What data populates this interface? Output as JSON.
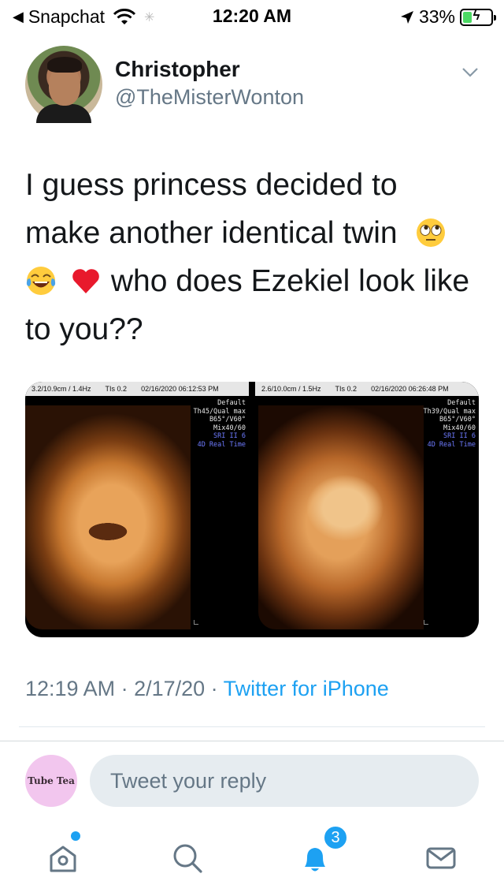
{
  "status_bar": {
    "back_app": "Snapchat",
    "time": "12:20 AM",
    "battery_percent": "33%",
    "battery_level": 0.33,
    "icons": [
      "back-arrow-icon",
      "wifi-icon",
      "loading-spinner-icon",
      "location-arrow-icon",
      "battery-charging-icon"
    ]
  },
  "tweet": {
    "display_name": "Christopher",
    "handle": "@TheMisterWonton",
    "text_lines": [
      "I guess princess decided to",
      "make another identical twin",
      "who does Ezekiel look like",
      "to you??"
    ],
    "emojis": [
      "face-with-rolling-eyes",
      "face-with-tears-of-joy",
      "red-heart"
    ],
    "timestamp": "12:19 AM · 2/17/20 · ",
    "source": "Twitter for iPhone"
  },
  "media": {
    "scan_left": {
      "top_params": "3.2/10.9cm / 1.4Hz",
      "top_tis": "TIs 0.2",
      "top_date": "02/16/2020  06:12:53 PM",
      "info": [
        "Default",
        "Th45/Qual max",
        "B65°/V60°",
        "Mix40/60"
      ],
      "info_blue": [
        "SRI II 6",
        "4D Real Time"
      ]
    },
    "scan_right": {
      "top_params": "2.6/10.0cm / 1.5Hz",
      "top_tis": "TIs 0.2",
      "top_date": "02/16/2020  06:26:48 PM",
      "info": [
        "Default",
        "Th39/Qual max",
        "B65°/V60°",
        "Mix40/60"
      ],
      "info_blue": [
        "SRI II 6",
        "4D Real Time"
      ]
    }
  },
  "reply": {
    "avatar_text": "Tube Tea",
    "placeholder": "Tweet your reply"
  },
  "tab_bar": {
    "items": [
      "home-icon",
      "search-icon",
      "notifications-icon",
      "messages-icon"
    ],
    "notification_count": "3"
  },
  "colors": {
    "accent": "#1da1f2",
    "secondary_text": "#657786",
    "reply_bg": "#e6ecf0",
    "battery_green": "#4cd964"
  }
}
